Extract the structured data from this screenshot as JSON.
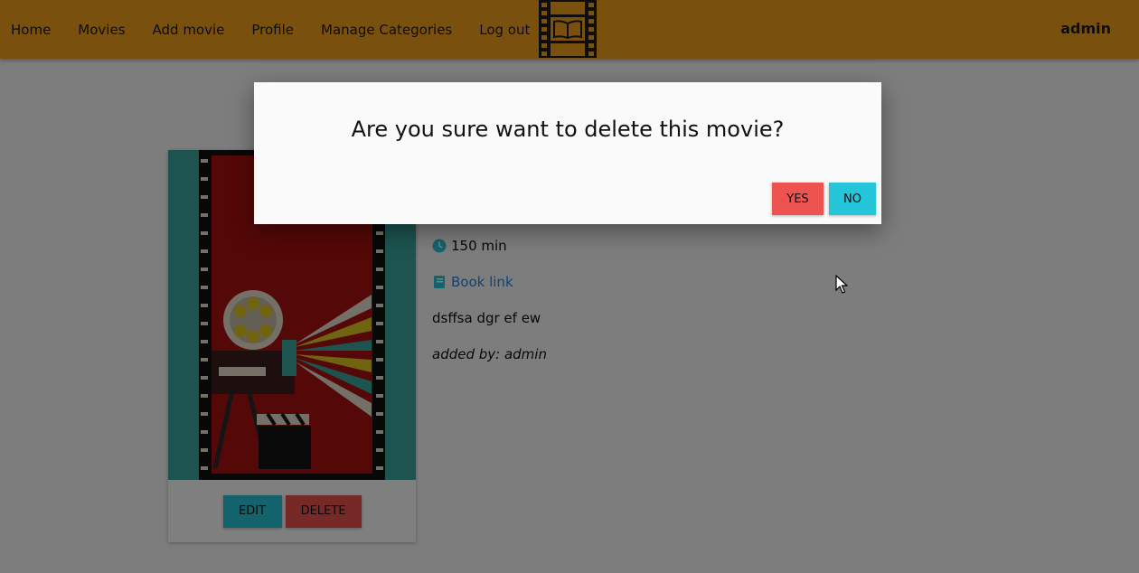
{
  "navbar": {
    "links": [
      "Home",
      "Movies",
      "Add movie",
      "Profile",
      "Manage Categories",
      "Log out"
    ],
    "user": "admin",
    "bg_color": "#f4a11d"
  },
  "movie": {
    "duration": "150 min",
    "book_link": "Book link",
    "description": "dsffsa dgr ef ew",
    "added_by": "added by: admin",
    "edit_label": "EDIT",
    "delete_label": "DELETE"
  },
  "modal": {
    "title": "Are you sure want to delete this movie?",
    "yes_label": "YES",
    "no_label": "NO"
  },
  "colors": {
    "accent_cyan": "#26c6da",
    "danger_red": "#ef5350",
    "link_blue": "#1e88e5"
  }
}
